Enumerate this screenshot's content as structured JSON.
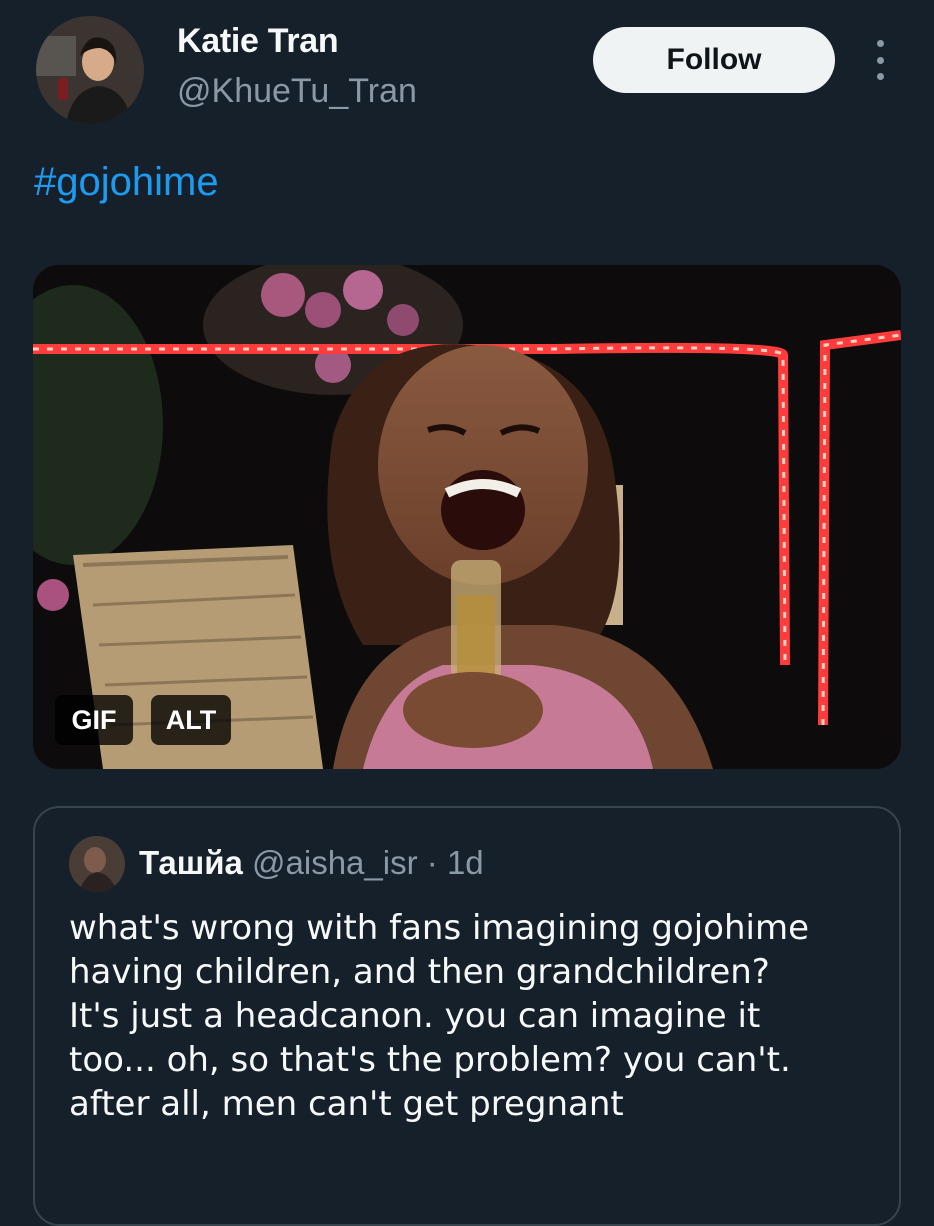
{
  "author": {
    "display_name": "Katie Tran",
    "handle": "@KhueTu_Tran",
    "avatar_icon": "user-avatar"
  },
  "follow_label": "Follow",
  "more_icon": "more-options-icon",
  "post": {
    "hashtag": "#gojohime",
    "media": {
      "gif_badge": "GIF",
      "alt_badge": "ALT"
    }
  },
  "quoted_post": {
    "display_name": "Ташйа",
    "handle": "@aisha_isr",
    "separator": "·",
    "time": "1d",
    "text_lines": [
      "what's wrong with fans imagining gojohime",
      "having children, and then grandchildren?",
      "It's just a headcanon. you can imagine it",
      "too... oh, so that's the problem? you can't.",
      "after all, men can't get pregnant"
    ]
  },
  "colors": {
    "background": "#15202b",
    "text_primary": "#f7f9f9",
    "text_secondary": "#8b98a5",
    "link": "#1d9bf0",
    "follow_button_bg": "#eff3f4",
    "border": "#38444d"
  }
}
